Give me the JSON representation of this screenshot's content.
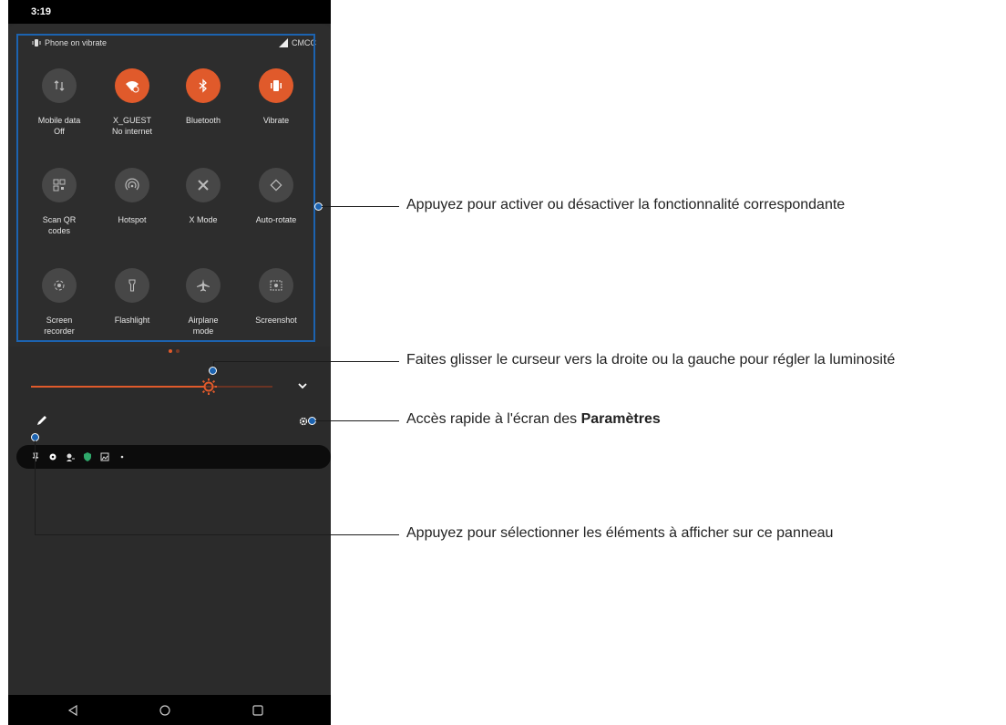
{
  "status_bar": {
    "time": "3:19"
  },
  "qs_header": {
    "mode": "Phone on vibrate",
    "carrier": "CMCC"
  },
  "tiles": [
    {
      "line1": "Mobile data",
      "line2": "Off",
      "icon": "mobile-data-icon",
      "on": false
    },
    {
      "line1": "X_GUEST",
      "line2": "No internet",
      "icon": "wifi-icon",
      "on": true
    },
    {
      "line1": "Bluetooth",
      "line2": "",
      "icon": "bluetooth-icon",
      "on": true
    },
    {
      "line1": "Vibrate",
      "line2": "",
      "icon": "vibrate-icon",
      "on": true
    },
    {
      "line1": "Scan QR",
      "line2": "codes",
      "icon": "qr-icon",
      "on": false
    },
    {
      "line1": "Hotspot",
      "line2": "",
      "icon": "hotspot-icon",
      "on": false
    },
    {
      "line1": "X Mode",
      "line2": "",
      "icon": "x-mode-icon",
      "on": false
    },
    {
      "line1": "Auto-rotate",
      "line2": "",
      "icon": "auto-rotate-icon",
      "on": false
    },
    {
      "line1": "Screen",
      "line2": "recorder",
      "icon": "screen-recorder-icon",
      "on": false
    },
    {
      "line1": "Flashlight",
      "line2": "",
      "icon": "flashlight-icon",
      "on": false
    },
    {
      "line1": "Airplane",
      "line2": "mode",
      "icon": "airplane-icon",
      "on": false
    },
    {
      "line1": "Screenshot",
      "line2": "",
      "icon": "screenshot-icon",
      "on": false
    }
  ],
  "brightness": {
    "level": 0.74
  },
  "callouts": {
    "tiles": "Appuyez pour activer ou désactiver la fonctionnalité correspondante",
    "brightness": "Faites glisser le curseur vers la droite ou la gauche pour régler la luminosité",
    "settings_prefix": "Accès rapide à l'écran des ",
    "settings_bold": "Paramètres",
    "edit": "Appuyez pour sélectionner les éléments à afficher sur ce panneau"
  },
  "colors": {
    "accent": "#e05a2b",
    "callout_blue": "#1c63b0",
    "panel": "#2b2b2b"
  }
}
